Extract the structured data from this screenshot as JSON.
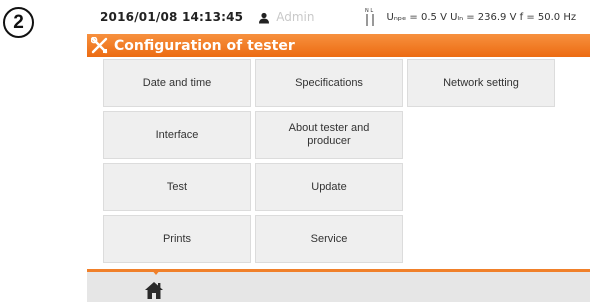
{
  "step_number": "2",
  "status_bar": {
    "datetime": "2016/01/08 14:13:45",
    "user_icon": "user-icon",
    "user": "Admin",
    "nl_icon": "network-lines-icon",
    "measurement": "Uₙₚₑ = 0.5 V Uₗₙ = 236.9 V f = 50.0 Hz"
  },
  "title_bar": {
    "icon": "tools-icon",
    "title": "Configuration of tester"
  },
  "tiles": [
    {
      "label": "Date and time"
    },
    {
      "label": "Specifications"
    },
    {
      "label": "Network setting"
    },
    {
      "label": "Interface"
    },
    {
      "label": "About tester and producer"
    },
    {
      "label": "Test"
    },
    {
      "label": "Update"
    },
    {
      "label": "Prints"
    },
    {
      "label": "Service"
    }
  ],
  "bottom_bar": {
    "home_icon": "home-icon"
  },
  "colors": {
    "accent": "#ec6b12",
    "tile_bg": "#efefef",
    "bottom_bg": "#e6e6e6"
  }
}
